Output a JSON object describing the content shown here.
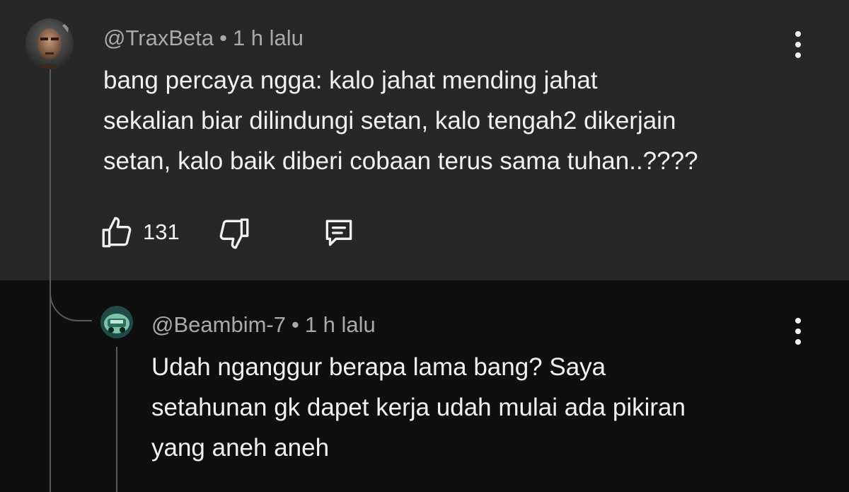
{
  "comment": {
    "username": "@TraxBeta",
    "separator": "•",
    "time": "1 h lalu",
    "text_lines": [
      "bang percaya ngga: kalo jahat mending jahat",
      "sekalian biar dilindungi setan, kalo tengah2 dikerjain",
      "setan, kalo baik diberi cobaan terus sama tuhan..????"
    ],
    "like_count": "131",
    "icons": {
      "like": "thumbs-up-icon",
      "dislike": "thumbs-down-icon",
      "reply": "comment-reply-icon",
      "menu": "more-vertical-icon"
    }
  },
  "reply": {
    "username": "@Beambim-7",
    "separator": "•",
    "time": "1 h lalu",
    "text_lines": [
      "Udah nganggur berapa lama bang? Saya",
      "setahunan gk dapet kerja udah mulai ada pikiran",
      "yang aneh aneh"
    ],
    "icons": {
      "menu": "more-vertical-icon"
    }
  },
  "colors": {
    "top_background": "#272727",
    "bottom_background": "#0f0f0f",
    "meta_text": "#aaaaaa",
    "body_text": "#f1f1f1",
    "thread_line": "#5a5a5a"
  }
}
